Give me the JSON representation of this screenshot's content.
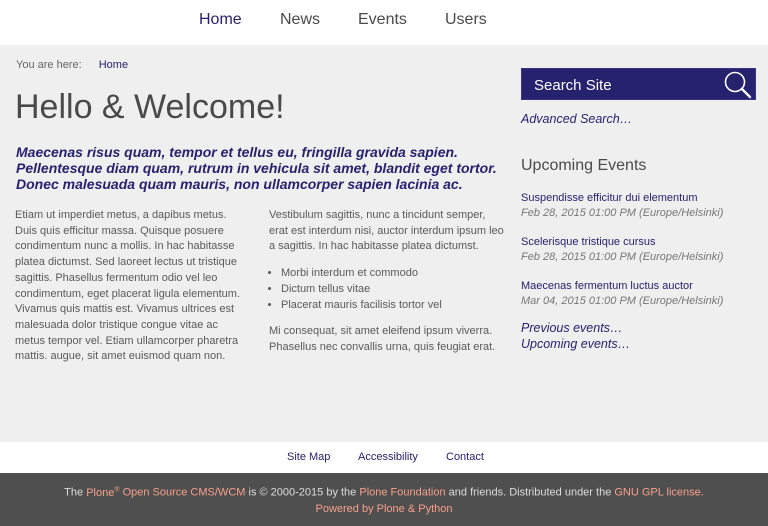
{
  "nav": {
    "items": [
      {
        "label": "Home",
        "active": true
      },
      {
        "label": "News"
      },
      {
        "label": "Events"
      },
      {
        "label": "Users"
      }
    ]
  },
  "breadcrumb": {
    "prefix": "You are here:",
    "home": "Home"
  },
  "main": {
    "title": "Hello & Welcome!",
    "lead": "Maecenas risus quam, tempor et tellus eu, fringilla gravida sapien. Pellentesque diam quam, rutrum in vehicula sit amet, blandit eget tortor. Donec malesuada quam mauris, non ullamcorper sapien lacinia ac.",
    "left_paragraph": "Etiam ut imperdiet metus, a dapibus metus. Duis quis efficitur massa. Quisque posuere condimentum nunc a mollis. In hac habitasse platea dictumst. Sed laoreet lectus ut tristique sagittis. Phasellus fermentum odio vel leo condimentum, eget placerat ligula elementum. Vivamus quis mattis est. Vivamus ultrices est malesuada dolor tristique congue vitae ac metus tempor vel. Etiam ullamcorper pharetra mattis.  augue, sit amet euismod quam non.",
    "right_paragraph1": "Vestibulum sagittis, nunc a tincidunt semper, erat est interdum nisi, auctor interdum ipsum leo a sagittis. In hac habitasse platea dictumst.",
    "bullets": [
      "Morbi interdum et commodo",
      "Dictum tellus vitae",
      "Placerat mauris facilisis tortor vel"
    ],
    "right_paragraph2": "Mi consequat, sit amet eleifend ipsum viverra. Phasellus nec convallis urna, quis feugiat erat."
  },
  "sidebar": {
    "search_placeholder": "Search Site",
    "search_icon": "magnifier-icon",
    "advanced_search": "Advanced Search…",
    "events_heading": "Upcoming Events",
    "events": [
      {
        "title": "Suspendisse efficitur dui elementum",
        "date": "Feb 28, 2015 01:00 PM (Europe/Helsinki)"
      },
      {
        "title": "Scelerisque tristique cursus",
        "date": "Feb 28, 2015 01:00 PM (Europe/Helsinki)"
      },
      {
        "title": "Maecenas fermentum luctus auctor",
        "date": "Mar 04, 2015 01:00 PM (Europe/Helsinki)"
      }
    ],
    "previous_events": "Previous events…",
    "upcoming_events": "Upcoming events…"
  },
  "site_actions": {
    "sitemap": "Site Map",
    "accessibility": "Accessibility",
    "contact": "Contact"
  },
  "footer": {
    "the": "The",
    "plone": "Plone",
    "reg": "®",
    "open_source": "Open Source CMS/WCM",
    "copyright": "is © 2000-2015 by the",
    "foundation": "Plone Foundation",
    "friends": "and friends. Distributed under the",
    "license": "GNU GPL license.",
    "powered_by": "Powered by Plone & Python"
  },
  "colors": {
    "accent": "#27226e",
    "footer_bg": "#4f4f4f",
    "footer_link": "#f4a08c",
    "page_bg": "#efefef"
  }
}
